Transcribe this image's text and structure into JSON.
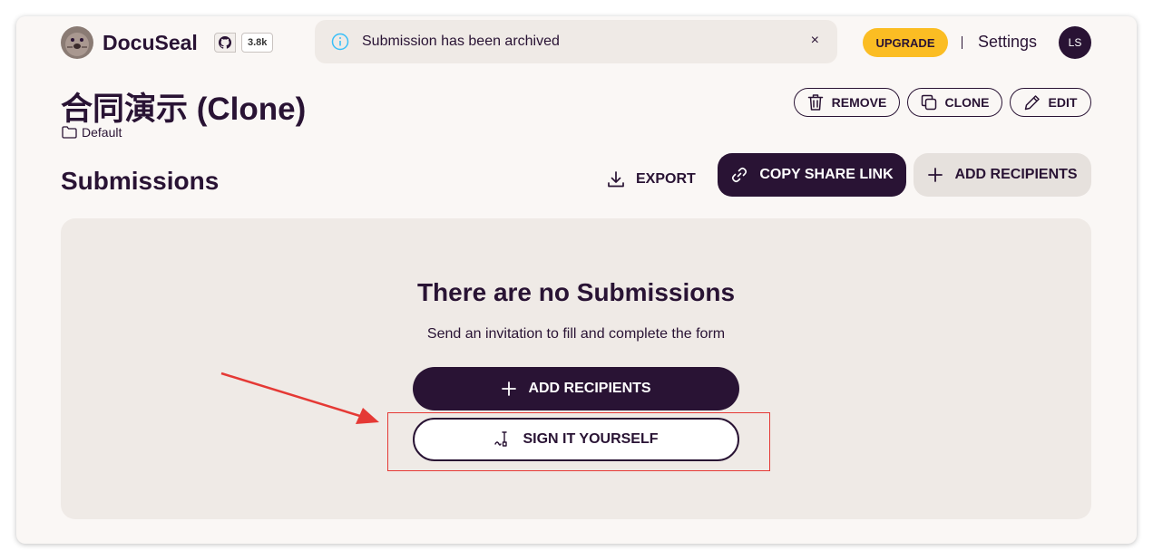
{
  "header": {
    "brand": "DocuSeal",
    "github_stars": "3.8k",
    "toast": {
      "message": "Submission has been archived",
      "close": "×"
    },
    "upgrade_label": "UPGRADE",
    "settings_label": "Settings",
    "avatar_initials": "LS"
  },
  "template": {
    "title": "合同演示 (Clone)",
    "folder": "Default",
    "actions": {
      "remove": "REMOVE",
      "clone": "CLONE",
      "edit": "EDIT"
    }
  },
  "submissions": {
    "title": "Submissions",
    "export_label": "EXPORT",
    "copy_link_label": "COPY SHARE LINK",
    "add_recipients_label": "ADD RECIPIENTS",
    "empty": {
      "title": "There are no Submissions",
      "subtitle": "Send an invitation to fill and complete the form",
      "add_recipients_label": "ADD RECIPIENTS",
      "sign_yourself_label": "SIGN IT YOURSELF"
    }
  },
  "colors": {
    "primary": "#291334",
    "accent_yellow": "#fbbd23",
    "annotation_red": "#e53935",
    "info_blue": "#3abff8"
  }
}
